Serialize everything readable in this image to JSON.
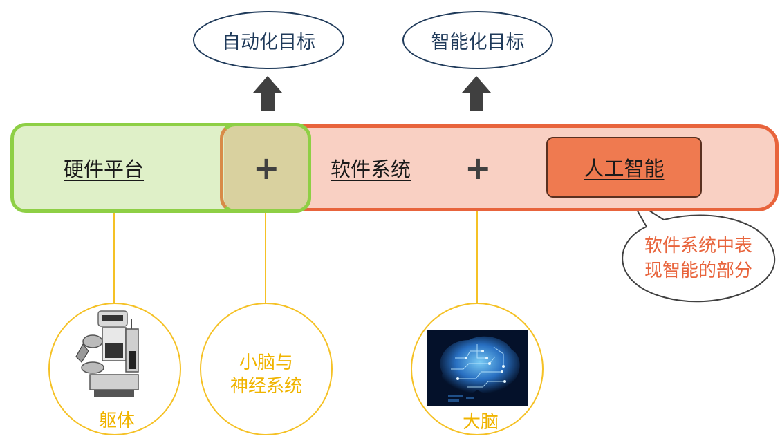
{
  "goals": {
    "automation": "自动化目标",
    "intelligence": "智能化目标"
  },
  "hardware": {
    "label": "硬件平台"
  },
  "software": {
    "label": "软件系统"
  },
  "plus_symbol": "+",
  "ai": {
    "label": "人工智能"
  },
  "callout": {
    "line1": "软件系统中表",
    "line2": "现智能的部分"
  },
  "circles": {
    "body": {
      "label": "躯体"
    },
    "cerebellum": {
      "line1": "小脑与",
      "line2": "神经系统"
    },
    "brain": {
      "label": "大脑"
    }
  },
  "colors": {
    "hardware_fill": "#dff0c8",
    "hardware_border": "#8ecf45",
    "software_fill": "#f9d0c3",
    "software_border": "#e8643c",
    "ai_fill": "#ef7a50",
    "goal_border": "#1f3a5a",
    "circle_border": "#f5c125",
    "circle_text": "#f0b400"
  }
}
